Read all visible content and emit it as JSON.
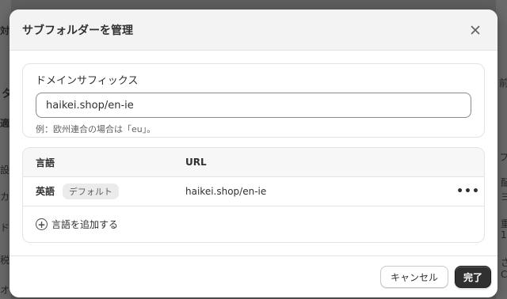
{
  "background": {
    "left_fragments": [
      "対象",
      "タ",
      "適",
      "設",
      "カ",
      "ド",
      "税",
      "オ"
    ],
    "right_fragments": [
      "前",
      "フ",
      "配",
      "ヨ",
      "重",
      "1",
      "さ",
      "C"
    ]
  },
  "modal": {
    "title": "サブフォルダーを管理",
    "close_icon": "close-icon"
  },
  "suffix": {
    "label": "ドメインサフィックス",
    "value": "haikei.shop/en-ie",
    "help": "例：欧州連合の場合は「eu」。"
  },
  "languages": {
    "headers": {
      "language": "言語",
      "url": "URL"
    },
    "rows": [
      {
        "name": "英語",
        "badge": "デフォルト",
        "url": "haikei.shop/en-ie",
        "more": "•••"
      }
    ],
    "add_label": "言語を追加する"
  },
  "footer": {
    "cancel": "キャンセル",
    "done": "完了"
  },
  "colors": {
    "primary_button": "#303030",
    "header_bg": "#f3f3f3",
    "backdrop": "#5e5e5e"
  }
}
